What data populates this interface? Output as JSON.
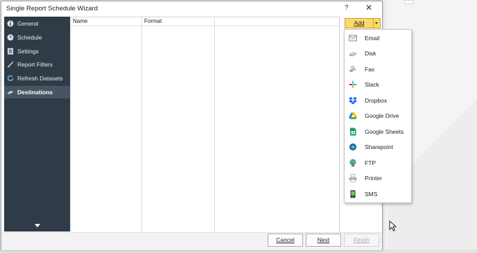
{
  "window": {
    "title": "Single Report Schedule Wizard",
    "help_label": "?",
    "close_label": "✕"
  },
  "sidebar": {
    "items": [
      {
        "label": "General",
        "icon": "info-icon"
      },
      {
        "label": "Schedule",
        "icon": "clock-icon"
      },
      {
        "label": "Settings",
        "icon": "settings-icon"
      },
      {
        "label": "Report Filters",
        "icon": "filter-icon"
      },
      {
        "label": "Refresh Datasets",
        "icon": "refresh-icon"
      },
      {
        "label": "Destinations",
        "icon": "destinations-icon",
        "active": true
      }
    ]
  },
  "grid": {
    "columns": [
      "Name",
      "Format",
      ""
    ]
  },
  "add_button": {
    "label": "Add"
  },
  "add_menu": {
    "items": [
      {
        "label": "Email",
        "icon": "email-icon"
      },
      {
        "label": "Disk",
        "icon": "disk-icon"
      },
      {
        "label": "Fax",
        "icon": "fax-icon"
      },
      {
        "label": "Slack",
        "icon": "slack-icon"
      },
      {
        "label": "Dropbox",
        "icon": "dropbox-icon"
      },
      {
        "label": "Google Drive",
        "icon": "google-drive-icon"
      },
      {
        "label": "Google Sheets",
        "icon": "google-sheets-icon"
      },
      {
        "label": "Sharepoint",
        "icon": "sharepoint-icon"
      },
      {
        "label": "FTP",
        "icon": "ftp-icon"
      },
      {
        "label": "Printer",
        "icon": "printer-icon"
      },
      {
        "label": "SMS",
        "icon": "sms-icon"
      }
    ]
  },
  "footer": {
    "cancel_label": "Cancel",
    "next_label": "Next",
    "finish_label": "Finish"
  },
  "colors": {
    "sidebar_bg": "#2f3b46",
    "sidebar_active": "#475563",
    "add_button": "#fbd96b"
  }
}
